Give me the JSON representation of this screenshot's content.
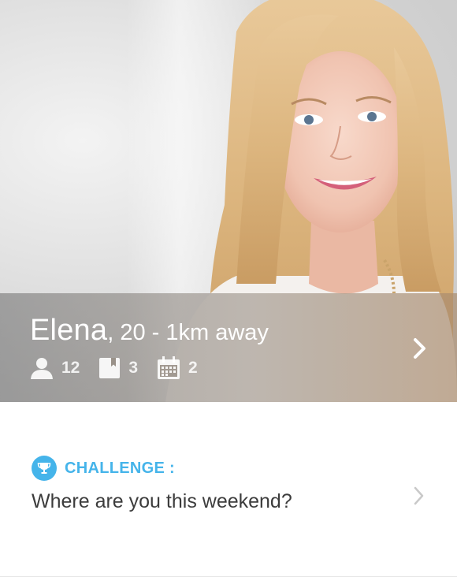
{
  "profile": {
    "name": "Elena",
    "details": ", 20 - 1km away",
    "photo_icon": "profile-photo",
    "stats": [
      {
        "icon": "person-icon",
        "value": "12"
      },
      {
        "icon": "book-icon",
        "value": "3"
      },
      {
        "icon": "calendar-icon",
        "value": "2"
      }
    ],
    "next_icon": "chevron-right-icon"
  },
  "challenge": {
    "icon": "trophy-icon",
    "label": "CHALLENGE :",
    "text": "Where are you this weekend?",
    "chevron_icon": "chevron-right-icon"
  },
  "colors": {
    "accent": "#45b4ea",
    "text": "#3c3c3c",
    "overlay_text": "#ffffff"
  }
}
